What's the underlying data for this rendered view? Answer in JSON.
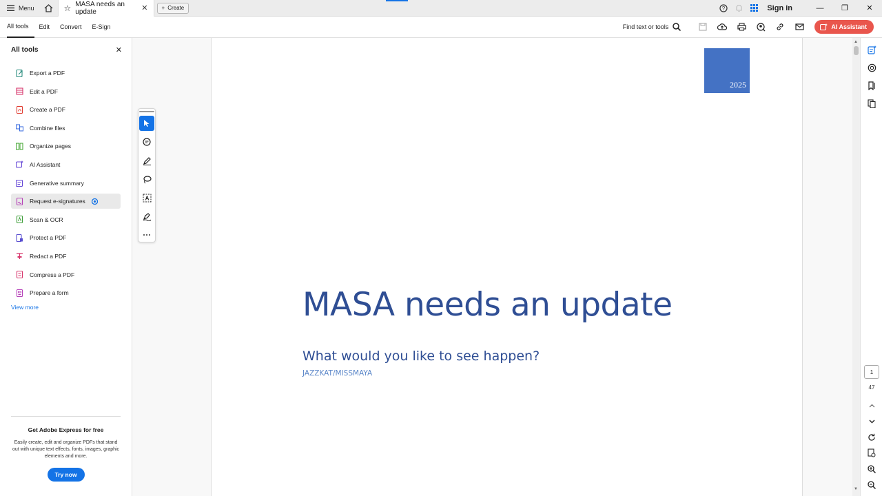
{
  "titlebar": {
    "menu_label": "Menu",
    "tab_title": "MASA needs an update",
    "create_label": "Create",
    "sign_in": "Sign in"
  },
  "toolbar": {
    "menus": [
      "All tools",
      "Edit",
      "Convert",
      "E-Sign"
    ],
    "find_label": "Find text or tools",
    "ai_assistant": "AI Assistant"
  },
  "sidebar": {
    "title": "All tools",
    "items": [
      {
        "label": "Export a PDF",
        "icon": "export-pdf-icon",
        "color": "#2a8c7e"
      },
      {
        "label": "Edit a PDF",
        "icon": "edit-pdf-icon",
        "color": "#d7346b"
      },
      {
        "label": "Create a PDF",
        "icon": "create-pdf-icon",
        "color": "#e03c31"
      },
      {
        "label": "Combine files",
        "icon": "combine-files-icon",
        "color": "#3c6ee0"
      },
      {
        "label": "Organize pages",
        "icon": "organize-pages-icon",
        "color": "#4aa83a"
      },
      {
        "label": "AI Assistant",
        "icon": "ai-assistant-icon",
        "color": "#6446d6"
      },
      {
        "label": "Generative summary",
        "icon": "generative-summary-icon",
        "color": "#6446d6"
      },
      {
        "label": "Request e-signatures",
        "icon": "request-esignatures-icon",
        "color": "#b540b8"
      },
      {
        "label": "Scan & OCR",
        "icon": "scan-ocr-icon",
        "color": "#3f9e3a"
      },
      {
        "label": "Protect a PDF",
        "icon": "protect-pdf-icon",
        "color": "#5a4fd0"
      },
      {
        "label": "Redact a PDF",
        "icon": "redact-pdf-icon",
        "color": "#d7346b"
      },
      {
        "label": "Compress a PDF",
        "icon": "compress-pdf-icon",
        "color": "#d7346b"
      },
      {
        "label": "Prepare a form",
        "icon": "prepare-form-icon",
        "color": "#b540b8"
      }
    ],
    "view_more": "View more",
    "promo": {
      "title": "Get Adobe Express for free",
      "description": "Easily create, edit and organize PDFs that stand out with unique text effects, fonts, images, graphic elements and more.",
      "button": "Try now"
    }
  },
  "document": {
    "year": "2025",
    "title": "MASA needs an update",
    "subtitle": "What would you like to see happen?",
    "author": "JAZZKAT/MISSMAYA"
  },
  "pager": {
    "current": "1",
    "total": "47"
  },
  "colors": {
    "accent": "#1473e6",
    "ai_button": "#e9564d",
    "title_blue": "#2f4e94",
    "year_box": "#4472c4"
  }
}
